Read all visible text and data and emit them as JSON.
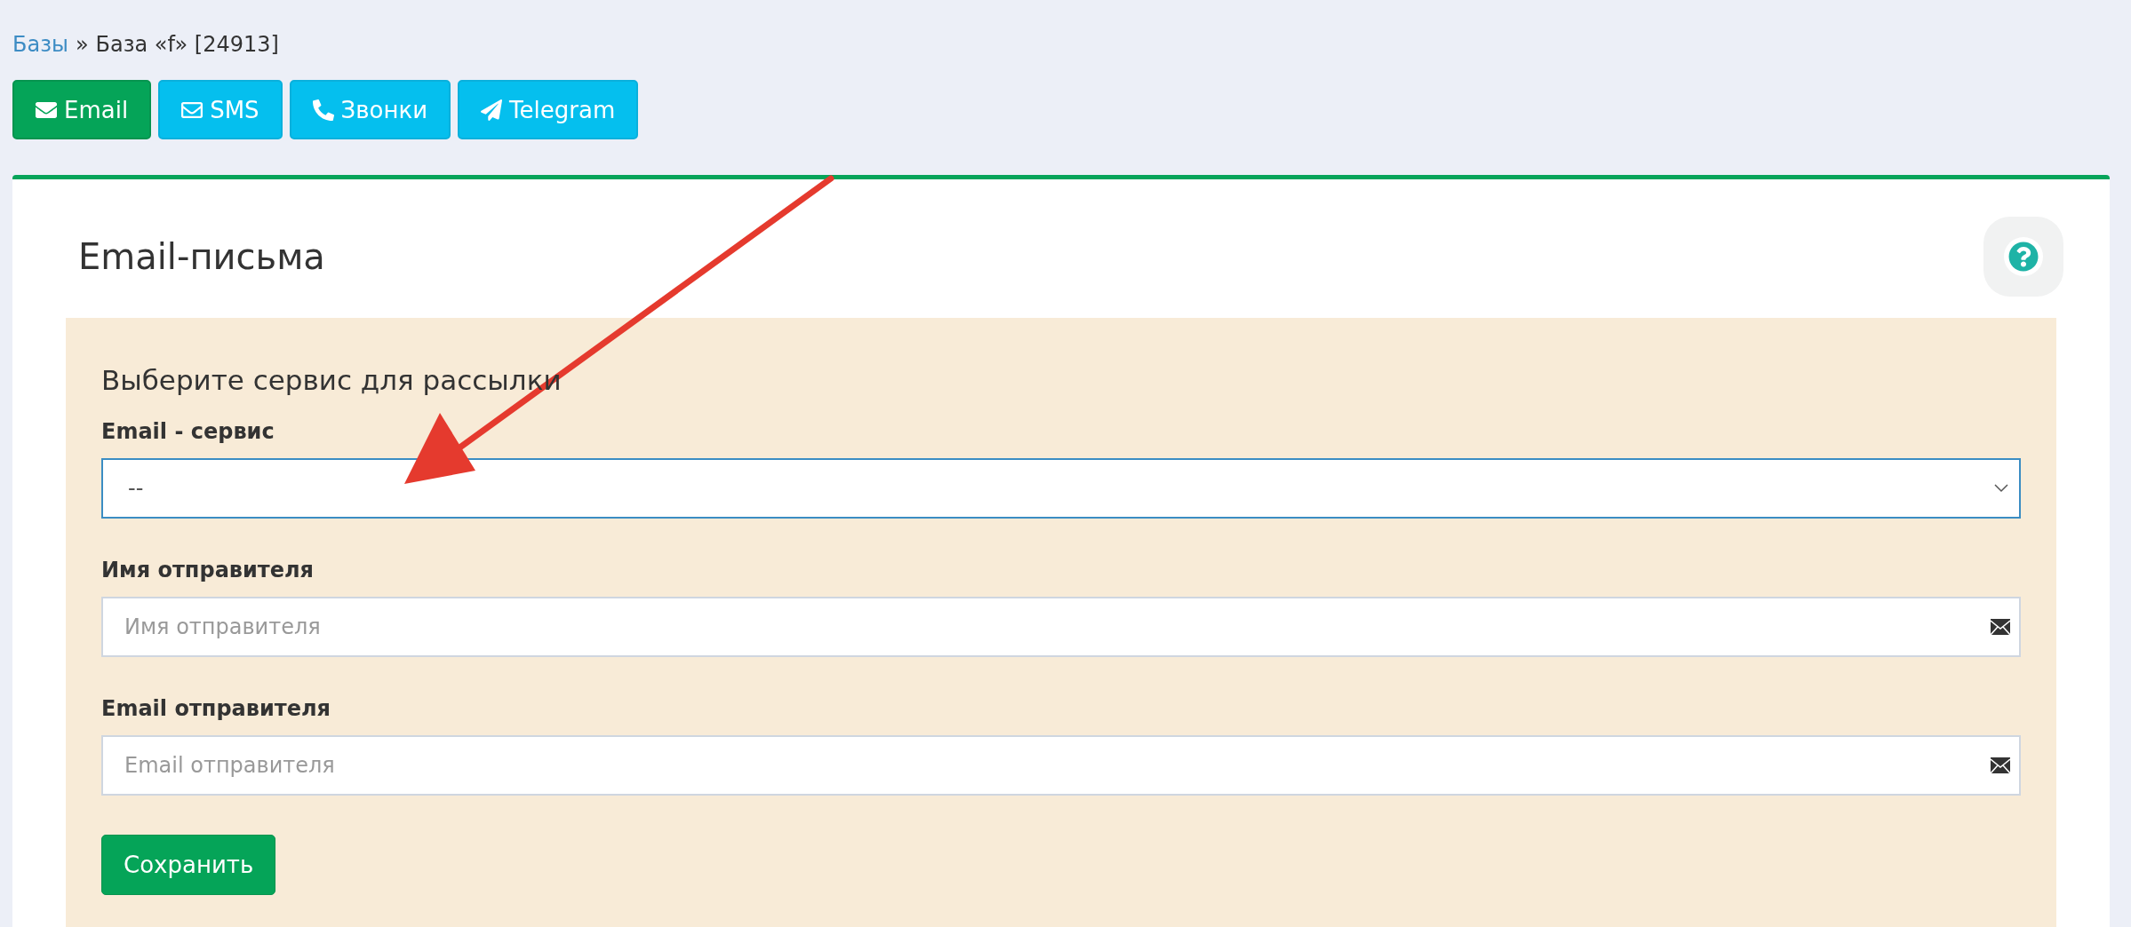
{
  "breadcrumb": {
    "link": "Базы",
    "separator": "»",
    "current": "База «f» [24913]"
  },
  "tabs": [
    {
      "label": "Email",
      "kind": "email",
      "selected": true
    },
    {
      "label": "SMS",
      "kind": "sms",
      "selected": false
    },
    {
      "label": "Звонки",
      "kind": "phone",
      "selected": false
    },
    {
      "label": "Telegram",
      "kind": "telegram",
      "selected": false
    }
  ],
  "card": {
    "title": "Email-письма",
    "form": {
      "heading": "Выберите сервис для рассылки",
      "fields": [
        {
          "kind": "select",
          "label": "Email - сервис",
          "value": "--",
          "focused": true
        },
        {
          "kind": "input",
          "label": "Имя отправителя",
          "placeholder": "Имя отправителя",
          "focused": false
        },
        {
          "kind": "input",
          "label": "Email отправителя",
          "placeholder": "Email отправителя",
          "focused": false
        }
      ],
      "submit": "Сохранить"
    }
  },
  "annotation": {
    "kind": "arrow"
  }
}
